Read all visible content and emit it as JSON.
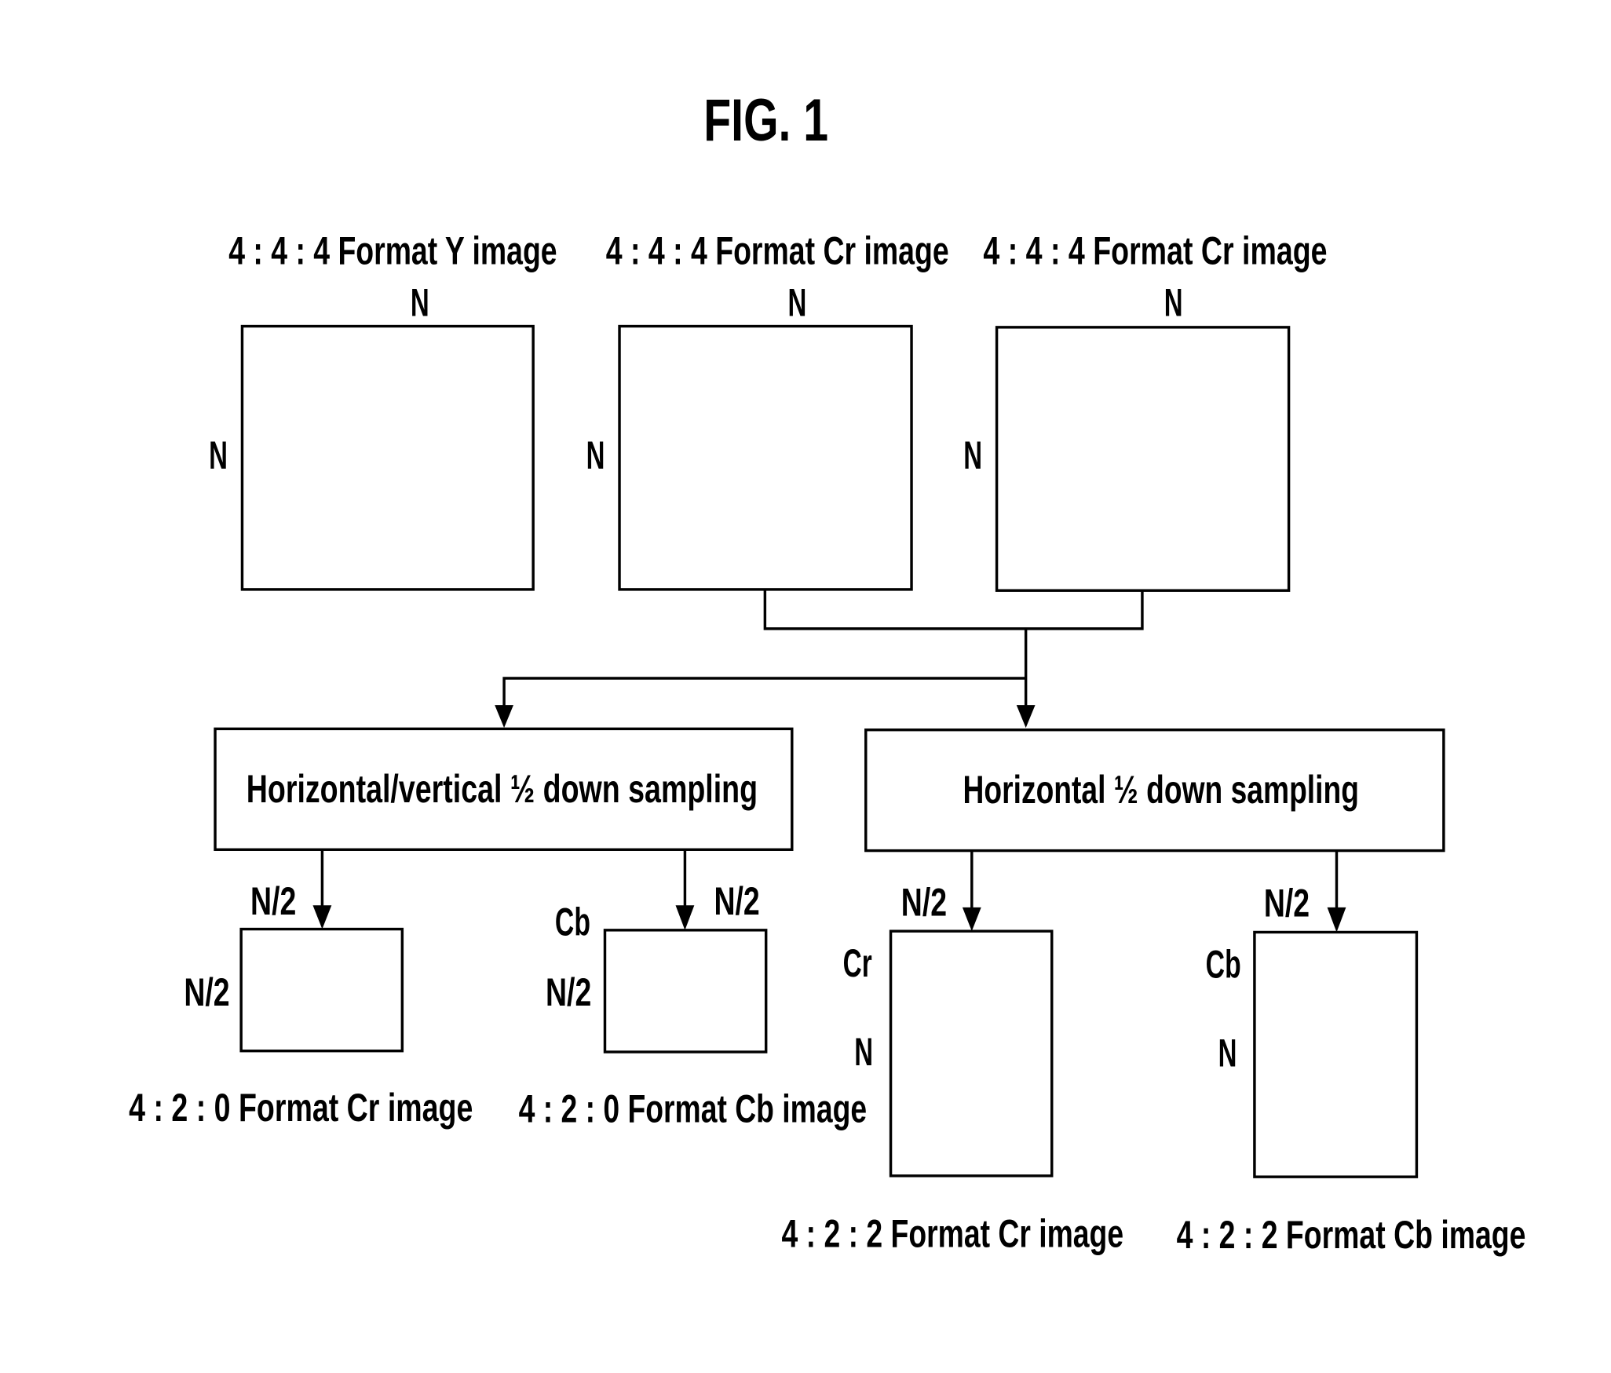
{
  "figure": {
    "title": "FIG. 1",
    "colors": {
      "line": "#000000",
      "background": "#ffffff"
    },
    "inputs": [
      {
        "label": "4 : 4 : 4 Format Y image",
        "width_label": "N",
        "height_label": "N"
      },
      {
        "label": "4 : 4 : 4 Format Cr image",
        "width_label": "N",
        "height_label": "N"
      },
      {
        "label": "4 : 4 : 4 Format Cr image",
        "width_label": "N",
        "height_label": "N"
      }
    ],
    "processes": [
      {
        "label": "Horizontal/vertical ½ down sampling"
      },
      {
        "label": "Horizontal ½ down sampling"
      }
    ],
    "outputs": [
      {
        "label": "4 : 2 : 0 Format Cr image",
        "width_label": "N/2",
        "height_label": "N/2",
        "component": ""
      },
      {
        "label": "4 : 2 : 0 Format Cb image",
        "width_label": "N/2",
        "height_label": "N/2",
        "component": "Cb"
      },
      {
        "label": "4 : 2 : 2 Format Cr image",
        "width_label": "N/2",
        "height_label": "N",
        "component": "Cr"
      },
      {
        "label": "4 : 2 : 2 Format Cb image",
        "width_label": "N/2",
        "height_label": "N",
        "component": "Cb"
      }
    ]
  }
}
